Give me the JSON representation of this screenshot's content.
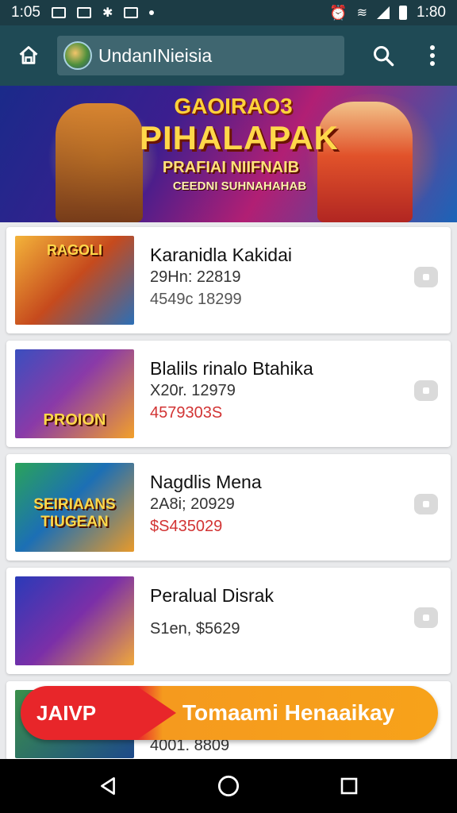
{
  "status_bar": {
    "time_left": "1:05",
    "time_right": "1:80"
  },
  "app_bar": {
    "title": "UndanINieisia"
  },
  "banner": {
    "line1": "GAOIRAO3",
    "line2": "PIHALAPAK",
    "line3": "PRAFIAI NIIFNAIB",
    "line4": "CEEDNI SUHNAHAHAB"
  },
  "items": [
    {
      "title": "Karanidla Kakidai",
      "meta": "29Hn: 22819",
      "price": "4549c 18299",
      "price_color": "#555555",
      "thumb_label": "RAGOLI"
    },
    {
      "title": "Blalils rinalo Btahika",
      "meta": "X20r. 12979",
      "price": "4579303S",
      "price_color": "#d23434",
      "thumb_label": "PROION"
    },
    {
      "title": "Nagdlis Mena",
      "meta": "2A8i; 20929",
      "price": "$S435029",
      "price_color": "#d23434",
      "thumb_label": "SEIRIAANS TIUGEAN"
    },
    {
      "title": "Peralual Disrak",
      "meta": "S1en, $5629",
      "price": "",
      "price_color": "#555555",
      "thumb_label": ""
    },
    {
      "title": "",
      "meta": "4001. 8809",
      "price": "",
      "price_color": "#555555",
      "thumb_label": ""
    }
  ],
  "cta": {
    "left_label": "JAIVP",
    "right_label": "Tomaami Henaaikay"
  },
  "icons": {
    "home": "home-icon",
    "search": "search-icon",
    "more": "more-vertical-icon",
    "back": "back-triangle-icon",
    "home_nav": "home-circle-icon",
    "recents": "recents-square-icon"
  },
  "colors": {
    "app_bar": "#1f4a55",
    "status_bar": "#1c3c45",
    "cta_red": "#e8262a",
    "cta_orange": "#f7a21a",
    "price_red": "#d23434"
  }
}
